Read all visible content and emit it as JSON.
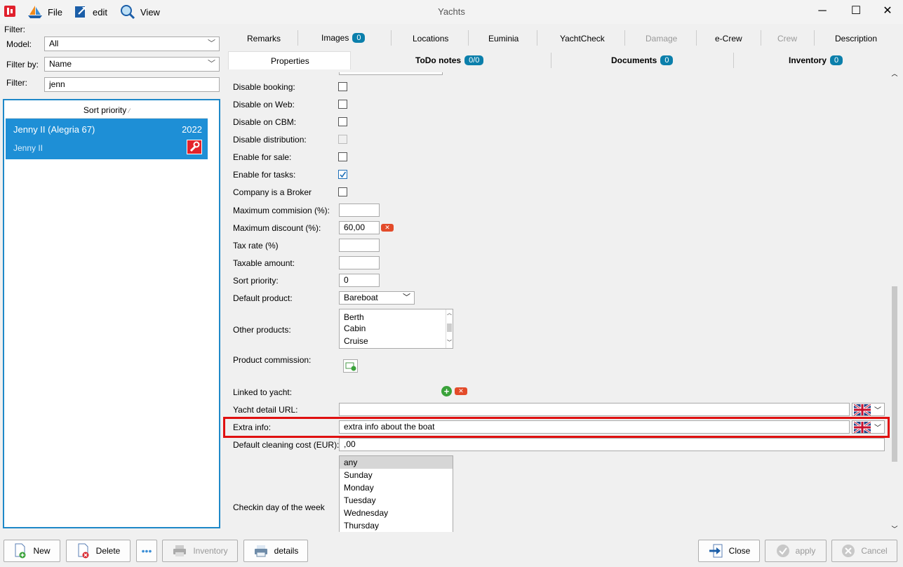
{
  "window": {
    "title": "Yachts"
  },
  "menu": {
    "file": "File",
    "edit": "edit",
    "view": "View"
  },
  "filter": {
    "heading": "Filter:",
    "model_label": "Model:",
    "model_value": "All",
    "filter_by_label": "Filter by:",
    "filter_by_value": "Name",
    "filter_label": "Filter:",
    "filter_value": "jenn"
  },
  "list": {
    "sort_header": "Sort priority",
    "sort_arrow": "⁄",
    "rows": [
      {
        "name": "Jenny II (Alegria 67)",
        "year": "2022",
        "subname": "Jenny II"
      }
    ]
  },
  "tabs_row1": [
    {
      "label": "Remarks"
    },
    {
      "label": "Images",
      "badge": "0"
    },
    {
      "label": "Locations"
    },
    {
      "label": "Euminia"
    },
    {
      "label": "YachtCheck"
    },
    {
      "label": "Damage",
      "disabled": true
    },
    {
      "label": "e-Crew"
    },
    {
      "label": "Crew",
      "disabled": true
    },
    {
      "label": "Description"
    }
  ],
  "tabs_row2": [
    {
      "label": "Properties"
    },
    {
      "label": "ToDo notes",
      "badge": "0/0"
    },
    {
      "label": "Documents",
      "badge": "0"
    },
    {
      "label": "Inventory",
      "badge": "0"
    }
  ],
  "form": {
    "disable_booking": "Disable booking:",
    "disable_web": "Disable on Web:",
    "disable_cbm": "Disable on CBM:",
    "disable_distribution": "Disable distribution:",
    "enable_sale": "Enable for sale:",
    "enable_tasks": "Enable for tasks:",
    "company_broker": "Company is a Broker",
    "max_commission": "Maximum commision (%):",
    "max_discount": "Maximum discount (%):",
    "max_discount_value": "60,00",
    "tax_rate": "Tax rate (%)",
    "taxable_amount": "Taxable amount:",
    "sort_priority": "Sort priority:",
    "sort_priority_value": "0",
    "default_product": "Default product:",
    "default_product_value": "Bareboat",
    "other_products": "Other products:",
    "other_products_options": [
      "Berth",
      "Cabin",
      "Cruise"
    ],
    "product_commission": "Product commission:",
    "linked_yacht": "Linked to yacht:",
    "detail_url": "Yacht detail URL:",
    "extra_info": "Extra info:",
    "extra_info_value": "extra info about the boat",
    "cleaning_cost": "Default cleaning cost (EUR):",
    "cleaning_cost_value": ",00",
    "checkin_day": "Checkin day of the week",
    "checkin_options": [
      "any",
      "Sunday",
      "Monday",
      "Tuesday",
      "Wednesday",
      "Thursday"
    ],
    "enable_tasks_checked": true
  },
  "buttons": {
    "new": "New",
    "delete": "Delete",
    "more": "•••",
    "inventory": "Inventory",
    "details": "details",
    "close": "Close",
    "apply": "apply",
    "cancel": "Cancel"
  },
  "colors": {
    "accent": "#1e8fd6",
    "badge": "#0b7fab",
    "highlight": "#e01010"
  }
}
